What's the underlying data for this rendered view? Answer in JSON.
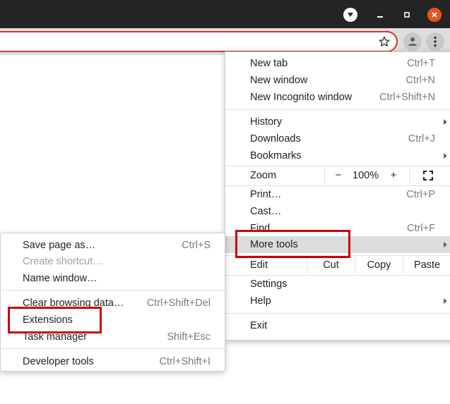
{
  "main_menu": {
    "new_tab": {
      "label": "New tab",
      "shortcut": "Ctrl+T"
    },
    "new_window": {
      "label": "New window",
      "shortcut": "Ctrl+N"
    },
    "new_incognito": {
      "label": "New Incognito window",
      "shortcut": "Ctrl+Shift+N"
    },
    "history": {
      "label": "History"
    },
    "downloads": {
      "label": "Downloads",
      "shortcut": "Ctrl+J"
    },
    "bookmarks": {
      "label": "Bookmarks"
    },
    "zoom": {
      "label": "Zoom",
      "minus": "−",
      "value": "100%",
      "plus": "+"
    },
    "print": {
      "label": "Print…",
      "shortcut": "Ctrl+P"
    },
    "cast": {
      "label": "Cast…"
    },
    "find": {
      "label": "Find",
      "shortcut": "Ctrl+F"
    },
    "more_tools": {
      "label": "More tools"
    },
    "edit": {
      "label": "Edit",
      "cut": "Cut",
      "copy": "Copy",
      "paste": "Paste"
    },
    "settings": {
      "label": "Settings"
    },
    "help": {
      "label": "Help"
    },
    "exit": {
      "label": "Exit"
    }
  },
  "more_tools_menu": {
    "save_page": {
      "label": "Save page as…",
      "shortcut": "Ctrl+S"
    },
    "create_shortcut": {
      "label": "Create shortcut…"
    },
    "name_window": {
      "label": "Name window…"
    },
    "clear_browsing": {
      "label": "Clear browsing data…",
      "shortcut": "Ctrl+Shift+Del"
    },
    "extensions": {
      "label": "Extensions"
    },
    "task_manager": {
      "label": "Task manager",
      "shortcut": "Shift+Esc"
    },
    "developer_tools": {
      "label": "Developer tools",
      "shortcut": "Ctrl+Shift+I"
    }
  },
  "colors": {
    "title_bar": "#242424",
    "close_button": "#e95420",
    "highlight_box": "#cc0000",
    "hover_item": "#dcdcdc"
  },
  "icons": {
    "titlebar_dropdown": "dropdown-arrow-icon",
    "minimize": "minimize-icon",
    "maximize": "maximize-icon",
    "close": "close-icon",
    "bookmark": "star-icon",
    "profile": "person-icon",
    "menu": "kebab-menu-icon",
    "fullscreen": "fullscreen-icon"
  }
}
